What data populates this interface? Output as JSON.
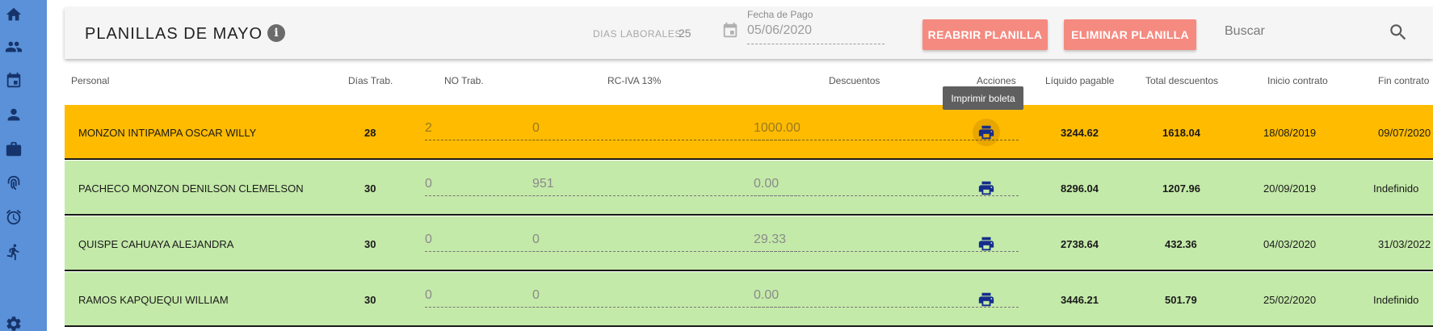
{
  "sidebar": {
    "icons": [
      "home-icon",
      "people-icon",
      "calendar-icon",
      "person-icon",
      "briefcase-icon",
      "fingerprint-icon",
      "alarm-icon",
      "running-icon",
      "settings-icon"
    ]
  },
  "toolbar": {
    "title": "PLANILLAS DE MAYO",
    "info_icon": "i",
    "dias_label": "DIAS LABORALES:",
    "dias_value": "25",
    "fecha_label": "Fecha de Pago",
    "fecha_value": "05/06/2020",
    "reabrir_label": "REABRIR PLANILLA",
    "eliminar_label": "ELIMINAR PLANILLA",
    "search_placeholder": "Buscar"
  },
  "table": {
    "headers": {
      "personal": "Personal",
      "dias": "Días Trab.",
      "no_trab": "NO Trab.",
      "rc_iva": "RC-IVA 13%",
      "descuentos": "Descuentos",
      "acciones": "Acciones",
      "liquido": "Líquido pagable",
      "total_desc": "Total descuentos",
      "inicio": "Inicio contrato",
      "fin": "Fin contrato"
    },
    "tooltip": "Imprimir boleta",
    "rows": [
      {
        "nombre": "MONZON INTIPAMPA OSCAR WILLY",
        "dias": "28",
        "no_trab": "2",
        "rc_iva": "0",
        "descuentos": "1000.00",
        "liquido": "3244.62",
        "total_desc": "1618.04",
        "inicio": "18/08/2019",
        "fin": "09/07/2020"
      },
      {
        "nombre": "PACHECO MONZON DENILSON CLEMELSON",
        "dias": "30",
        "no_trab": "0",
        "rc_iva": "951",
        "descuentos": "0.00",
        "liquido": "8296.04",
        "total_desc": "1207.96",
        "inicio": "20/09/2019",
        "fin": "Indefinido"
      },
      {
        "nombre": "QUISPE CAHUAYA ALEJANDRA",
        "dias": "30",
        "no_trab": "0",
        "rc_iva": "0",
        "descuentos": "29.33",
        "liquido": "2738.64",
        "total_desc": "432.36",
        "inicio": "04/03/2020",
        "fin": "31/03/2022"
      },
      {
        "nombre": "RAMOS KAPQUEQUI WILLIAM",
        "dias": "30",
        "no_trab": "0",
        "rc_iva": "0",
        "descuentos": "0.00",
        "liquido": "3446.21",
        "total_desc": "501.79",
        "inicio": "25/02/2020",
        "fin": "Indefinido"
      }
    ]
  },
  "colors": {
    "sidebar": "#5a91d8",
    "highlight_row": "#ffbb00",
    "normal_row": "#c4eaa9",
    "action_button": "#f58a80",
    "print_icon": "#152d8c"
  }
}
